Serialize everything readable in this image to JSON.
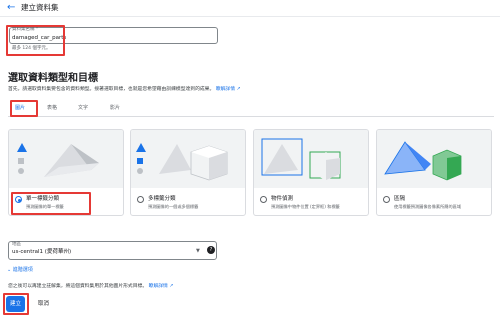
{
  "header": {
    "back_icon": "arrow-left-icon",
    "title": "建立資料集"
  },
  "name_field": {
    "label": "資料集名稱 *",
    "value": "damaged_car_parts",
    "hint": "最多 124 個字元。"
  },
  "section": {
    "title": "選取資料類型和目標",
    "description": "首先，請選取資料集要包含的資料類型。接著選取目標，也就是您希望藉由訓練模型達到的成果。",
    "learn_more": "瞭解詳情",
    "external_icon": "open-in-new-icon"
  },
  "tabs": [
    {
      "label": "圖片",
      "active": true
    },
    {
      "label": "表格",
      "active": false
    },
    {
      "label": "文字",
      "active": false
    },
    {
      "label": "影片",
      "active": false
    }
  ],
  "objectives": [
    {
      "title": "單一標籤分類",
      "desc": "預測圖像的單一標籤",
      "selected": true
    },
    {
      "title": "多標籤分類",
      "desc": "預測圖像的一個或多個標籤",
      "selected": false
    },
    {
      "title": "物件偵測",
      "desc": "預測圖像中物件位置 (定界框) 和標籤",
      "selected": false
    },
    {
      "title": "區隔",
      "desc": "使用標籤預測圖像各像素所屬的區域",
      "selected": false
    }
  ],
  "region": {
    "label": "地區",
    "value": "us-central1 (愛荷華州)",
    "help_icon": "help-icon"
  },
  "advanced": {
    "label": "進階選項",
    "icon": "chevron-down-icon"
  },
  "note": {
    "text": "您之後可以再建立註解集，將這個資料集用於其他圖片形式目標。",
    "link": "瞭解詳情"
  },
  "actions": {
    "create": "建立",
    "cancel": "取消"
  },
  "colors": {
    "accent": "#1a73e8",
    "highlight": "#e53935"
  }
}
